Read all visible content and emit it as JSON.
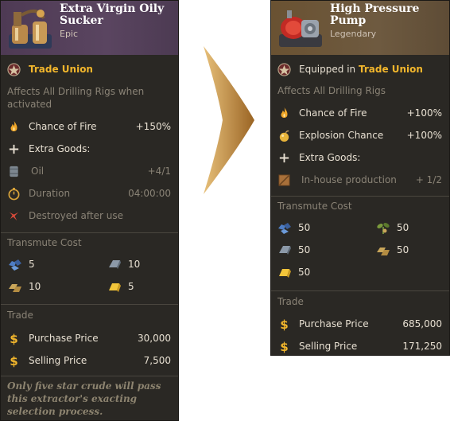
{
  "left_card": {
    "title": "Extra Virgin Oily Sucker",
    "rarity": "Epic",
    "faction": "Trade Union",
    "description": "Affects All Drilling Rigs when activated",
    "stats": [
      {
        "label": "Chance of Fire",
        "value": "+150%",
        "icon": "fire-icon"
      },
      {
        "label": "Extra Goods:",
        "value": "",
        "icon": "plus-icon"
      },
      {
        "label": "Oil",
        "value": "+4/1",
        "icon": "oil-barrel-icon"
      },
      {
        "label": "Duration",
        "value": "04:00:00",
        "icon": "stopwatch-icon"
      },
      {
        "label": "Destroyed after use",
        "value": "",
        "icon": "destroyed-icon"
      }
    ],
    "transmute_title": "Transmute Cost",
    "transmute": [
      {
        "icon": "ore-icon",
        "value": "5"
      },
      {
        "icon": "steel-ingot-icon",
        "value": "10"
      },
      {
        "icon": "bronze-ingot-icon",
        "value": "10"
      },
      {
        "icon": "gold-ingot-icon",
        "value": "5"
      }
    ],
    "trade_title": "Trade",
    "purchase_label": "Purchase Price",
    "purchase_value": "30,000",
    "selling_label": "Selling Price",
    "selling_value": "7,500",
    "flavor": "Only five star crude will pass this extractor's exacting selection process."
  },
  "right_card": {
    "title": "High Pressure Pump",
    "rarity": "Legendary",
    "equipped_prefix": "Equipped in",
    "faction": "Trade Union",
    "description": "Affects All Drilling Rigs",
    "stats": [
      {
        "label": "Chance of Fire",
        "value": "+100%",
        "icon": "fire-icon"
      },
      {
        "label": "Explosion Chance",
        "value": "+100%",
        "icon": "bomb-icon"
      },
      {
        "label": "Extra Goods:",
        "value": "",
        "icon": "plus-icon"
      },
      {
        "label": "In-house production",
        "value": "+ 1/2",
        "icon": "crate-icon"
      }
    ],
    "transmute_title": "Transmute Cost",
    "transmute": [
      {
        "icon": "ore-icon",
        "value": "50"
      },
      {
        "icon": "plant-icon",
        "value": "50"
      },
      {
        "icon": "steel-ingot-icon",
        "value": "50"
      },
      {
        "icon": "bronze-ingot-icon",
        "value": "50"
      },
      {
        "icon": "gold-ingot-icon",
        "value": "50"
      }
    ],
    "trade_title": "Trade",
    "purchase_label": "Purchase Price",
    "purchase_value": "685,000",
    "selling_label": "Selling Price",
    "selling_value": "171,250"
  },
  "colors": {
    "card_bg": "#2a2824",
    "epic_header": "#55425c",
    "legendary_header": "#6c5638",
    "accent_gold": "#f2b62c",
    "dim_text": "#8a8376",
    "arrow": "#a8742c"
  }
}
